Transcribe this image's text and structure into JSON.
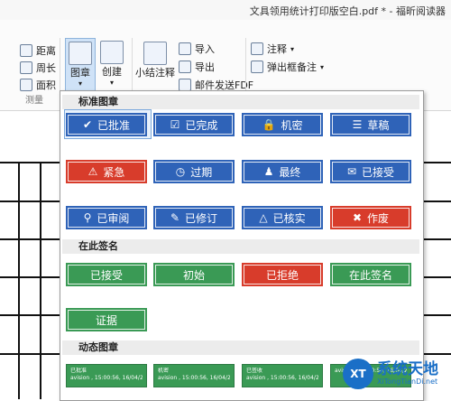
{
  "window": {
    "title": "文具领用统计打印版空白.pdf * - 福昕阅读器"
  },
  "ribbon": {
    "measure": {
      "distance": "距离",
      "perimeter": "周长",
      "area": "面积",
      "group": "测量"
    },
    "stamp_btn": "图章",
    "create_btn": "创建",
    "summary_btn": "小结注释",
    "import": "导入",
    "export": "导出",
    "email_pdf": "邮件发送FDF",
    "comment": "注释",
    "popup_note": "弹出框备注"
  },
  "panel": {
    "standard_title": "标准图章",
    "sign_here_title": "在此签名",
    "dynamic_title": "动态图章",
    "standard": [
      {
        "label": "已批准",
        "icon": "✔",
        "color": "#2f63b8",
        "selected": true
      },
      {
        "label": "已完成",
        "icon": "☑",
        "color": "#2f63b8"
      },
      {
        "label": "机密",
        "icon": "🔒",
        "color": "#2f63b8"
      },
      {
        "label": "草稿",
        "icon": "☰",
        "color": "#2f63b8"
      },
      {
        "label": "紧急",
        "icon": "⚠",
        "color": "#d83c2b"
      },
      {
        "label": "过期",
        "icon": "◷",
        "color": "#2f63b8"
      },
      {
        "label": "最终",
        "icon": "♟",
        "color": "#2f63b8"
      },
      {
        "label": "已接受",
        "icon": "✉",
        "color": "#2f63b8"
      },
      {
        "label": "已审阅",
        "icon": "⚲",
        "color": "#2f63b8"
      },
      {
        "label": "已修订",
        "icon": "✎",
        "color": "#2f63b8"
      },
      {
        "label": "已核实",
        "icon": "△",
        "color": "#2f63b8"
      },
      {
        "label": "作废",
        "icon": "✖",
        "color": "#d83c2b"
      }
    ],
    "sign_here": [
      {
        "label": "已接受",
        "color": "#3a9a55"
      },
      {
        "label": "初始",
        "color": "#3a9a55"
      },
      {
        "label": "已拒绝",
        "color": "#d83c2b"
      },
      {
        "label": "在此签名",
        "color": "#3a9a55"
      },
      {
        "label": "证据",
        "color": "#3a9a55"
      }
    ],
    "dynamic": [
      {
        "title": "已批准",
        "line": "avision , 15:00:56, 16/04/2014"
      },
      {
        "title": "机密",
        "line": "avision , 15:00:56, 16/04/2014"
      },
      {
        "title": "已签收",
        "line": "avision , 15:00:56, 16/04/2014"
      },
      {
        "title": "",
        "line": "avision , 15:00:56, 16/04/2014"
      }
    ]
  },
  "watermark": {
    "cn": "系统天地",
    "en": "XiTongTianDi.net"
  }
}
